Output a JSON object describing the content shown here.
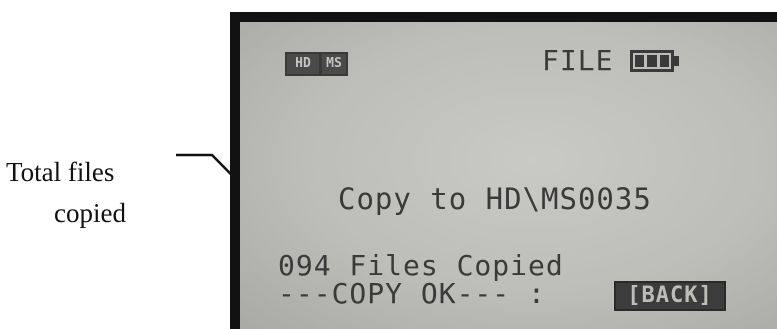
{
  "callout": {
    "line1": "Total files",
    "line2": "copied"
  },
  "status_bar": {
    "drive_hd": "HD",
    "drive_ms": "MS",
    "title": "FILE",
    "battery_icon": "battery-full-icon"
  },
  "message": {
    "copy_to": "Copy to HD\\MS0035",
    "files_copied": "094 Files Copied",
    "copy_ok": "---COPY OK--- :"
  },
  "buttons": {
    "back_label": "[BACK]"
  },
  "colors": {
    "lcd_background": "#c4c4c0",
    "lcd_text": "#3a3a3a",
    "frame": "#121212"
  }
}
